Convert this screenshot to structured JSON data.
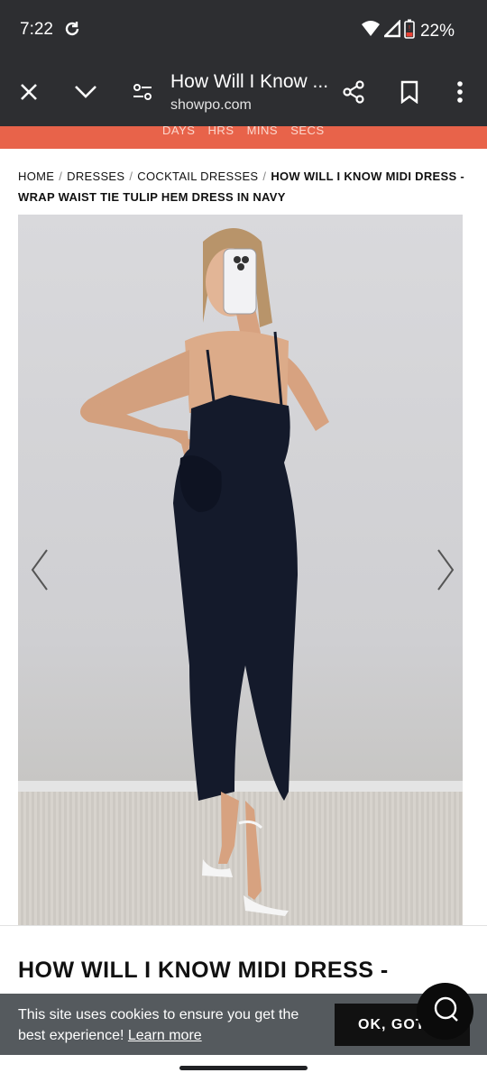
{
  "status_bar": {
    "time": "7:22",
    "battery": "22%"
  },
  "toolbar": {
    "title": "How Will I Know ...",
    "domain": "showpo.com"
  },
  "promo": {
    "labels": "DAYS HRS MINS SECS"
  },
  "breadcrumb": {
    "items": [
      "HOME",
      "DRESSES",
      "COCKTAIL DRESSES"
    ],
    "current": "HOW WILL I KNOW MIDI DRESS - WRAP WAIST TIE TULIP HEM DRESS IN NAVY",
    "separator": "/"
  },
  "product": {
    "heading": "HOW WILL I KNOW MIDI DRESS -"
  },
  "cookie": {
    "text": "This site uses cookies to ensure you get the best experience!",
    "link": "Learn more",
    "button": "OK, GOT"
  },
  "colors": {
    "chrome": "#2d2e31",
    "promo": "#e8634a",
    "cookie_bg": "#555a5e",
    "dress": "#141a2b"
  },
  "icons": [
    "sync-icon",
    "wifi-icon",
    "signal-icon",
    "battery-icon",
    "close-icon",
    "chevron-down-icon",
    "page-info-icon",
    "share-icon",
    "bookmark-icon",
    "more-vert-icon",
    "chevron-left-icon",
    "chevron-right-icon",
    "chat-icon"
  ]
}
